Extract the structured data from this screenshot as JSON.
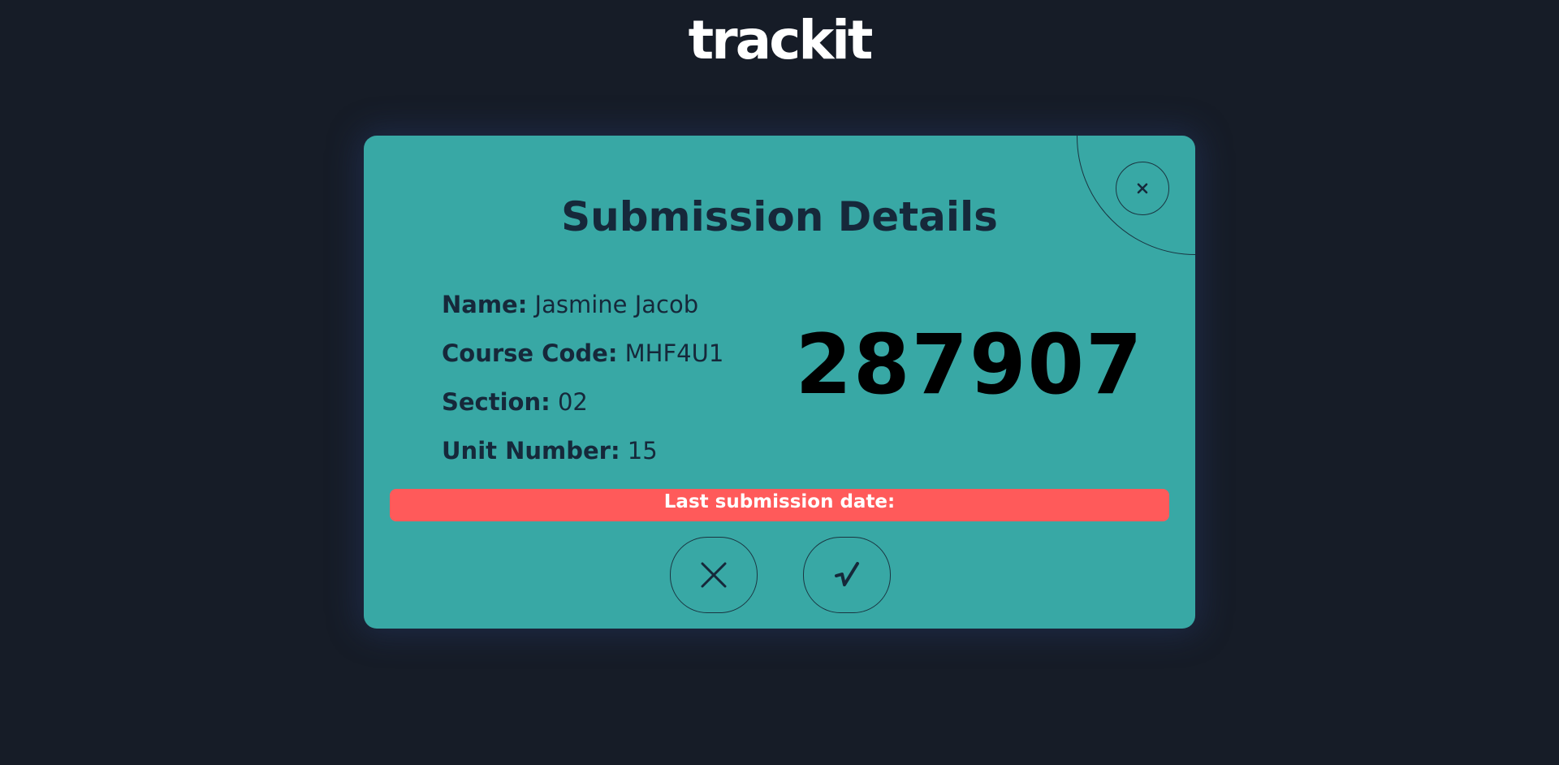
{
  "app": {
    "logo_text": "trackit"
  },
  "modal": {
    "title": "Submission Details",
    "fields": [
      {
        "label": "Name:",
        "value": "Jasmine Jacob"
      },
      {
        "label": "Course Code:",
        "value": "MHF4U1"
      },
      {
        "label": "Section:",
        "value": "02"
      },
      {
        "label": "Unit Number:",
        "value": "15"
      }
    ],
    "submission_code": "287907",
    "deadline_text": "Last submission date:",
    "close_icon": "close-icon",
    "reject_icon": "x-icon",
    "confirm_icon": "checkmark-icon"
  },
  "colors": {
    "background": "#161c27",
    "modal": "#38a8a5",
    "text_dark": "#16283a",
    "deadline_bar": "#ff5a5a"
  }
}
